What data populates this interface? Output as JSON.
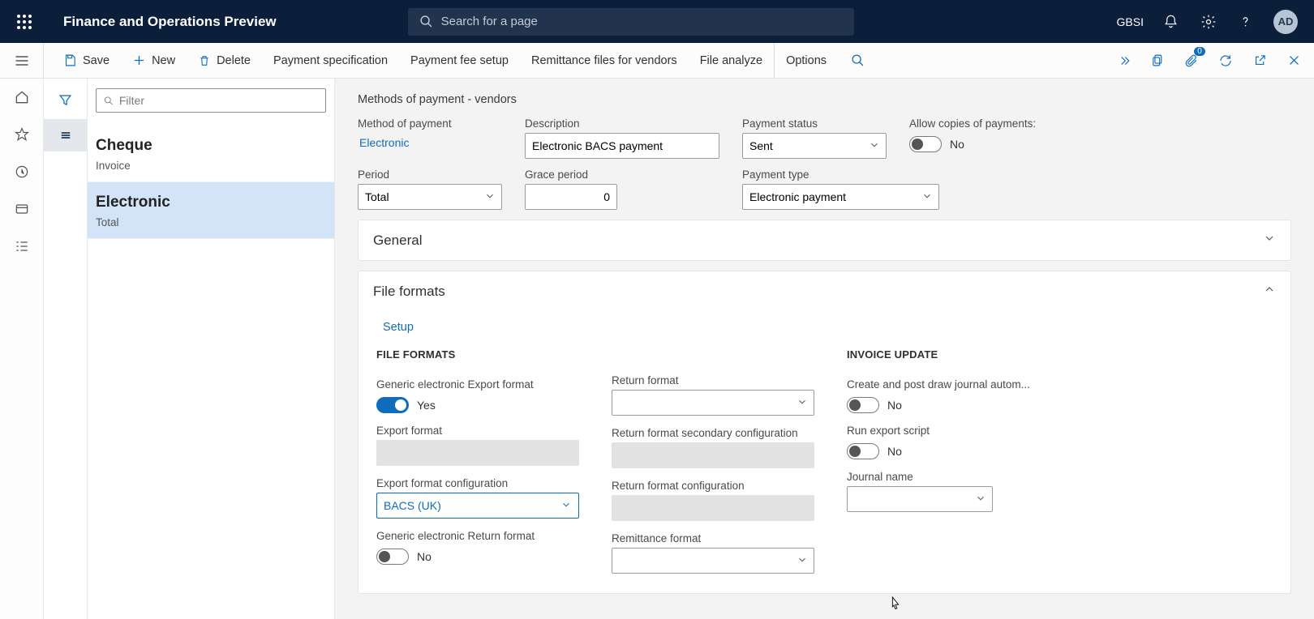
{
  "topbar": {
    "app_title": "Finance and Operations Preview",
    "search_placeholder": "Search for a page",
    "company": "GBSI",
    "avatar": "AD"
  },
  "actions": {
    "save": "Save",
    "new": "New",
    "delete": "Delete",
    "payment_spec": "Payment specification",
    "payment_fee": "Payment fee setup",
    "remittance": "Remittance files for vendors",
    "file_analyze": "File analyze",
    "options": "Options",
    "attach_badge": "0"
  },
  "list": {
    "filter_placeholder": "Filter",
    "items": [
      {
        "title": "Cheque",
        "sub": "Invoice"
      },
      {
        "title": "Electronic",
        "sub": "Total"
      }
    ]
  },
  "detail": {
    "crumb": "Methods of payment - vendors",
    "labels": {
      "method_of_payment": "Method of payment",
      "description": "Description",
      "payment_status": "Payment status",
      "allow_copies": "Allow copies of payments:",
      "period": "Period",
      "grace_period": "Grace period",
      "payment_type": "Payment type"
    },
    "values": {
      "method_of_payment": "Electronic",
      "description": "Electronic BACS payment",
      "payment_status": "Sent",
      "allow_copies": "No",
      "period": "Total",
      "grace_period": "0",
      "payment_type": "Electronic payment"
    },
    "general_header": "General",
    "file_formats_header": "File formats",
    "setup_link": "Setup",
    "file_formats": {
      "section1_header": "FILE FORMATS",
      "generic_export_label": "Generic electronic Export format",
      "generic_export_val": "Yes",
      "export_format_label": "Export format",
      "export_format_cfg_label": "Export format configuration",
      "export_format_cfg_val": "BACS (UK)",
      "generic_return_label": "Generic electronic Return format",
      "generic_return_val": "No",
      "return_format_label": "Return format",
      "return_secondary_cfg_label": "Return format secondary configuration",
      "return_cfg_label": "Return format configuration",
      "remittance_format_label": "Remittance format",
      "section3_header": "INVOICE UPDATE",
      "create_post_label": "Create and post draw journal autom...",
      "create_post_val": "No",
      "run_export_label": "Run export script",
      "run_export_val": "No",
      "journal_label": "Journal name"
    }
  }
}
